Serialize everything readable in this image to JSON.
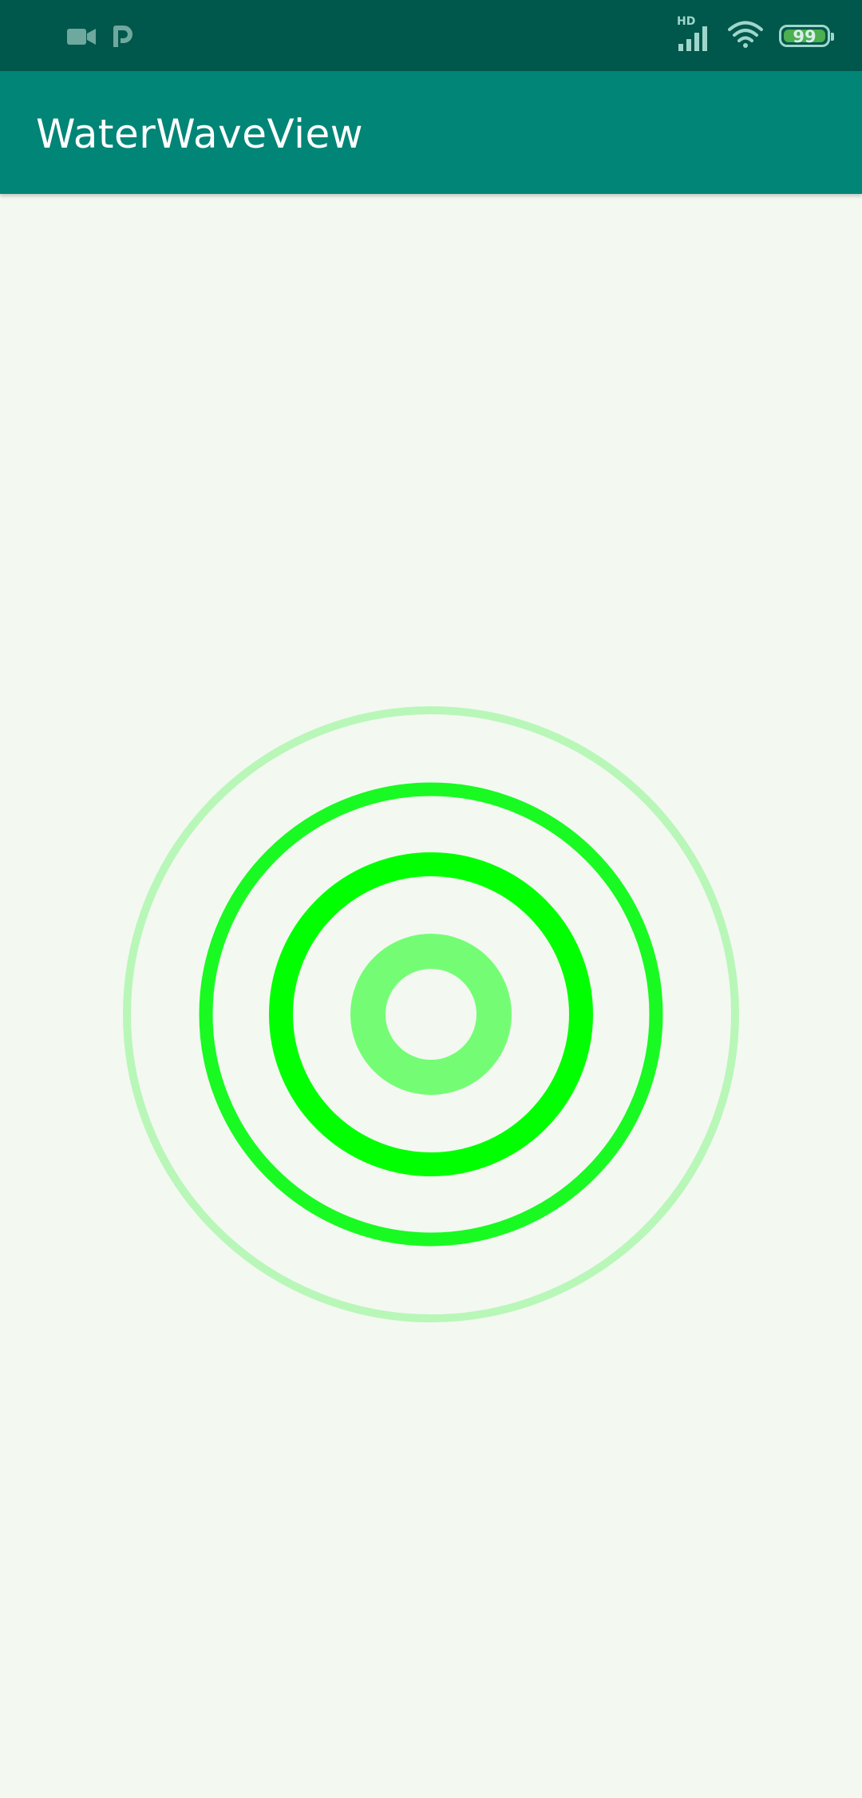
{
  "status_bar": {
    "icons_left": [
      "video-camera-icon",
      "parking-icon"
    ],
    "network_label": "HD",
    "icons_right": [
      "signal-icon",
      "wifi-icon",
      "battery-icon"
    ],
    "battery_level": "99",
    "background_color": "#00574b"
  },
  "app_bar": {
    "title": "WaterWaveView",
    "background_color": "#008577"
  },
  "wave_view": {
    "background_color": "#f3f8f1",
    "ring_color_strong": "#00ff00",
    "ring_color_light": "#b8f7b8",
    "ring_count": 4
  }
}
